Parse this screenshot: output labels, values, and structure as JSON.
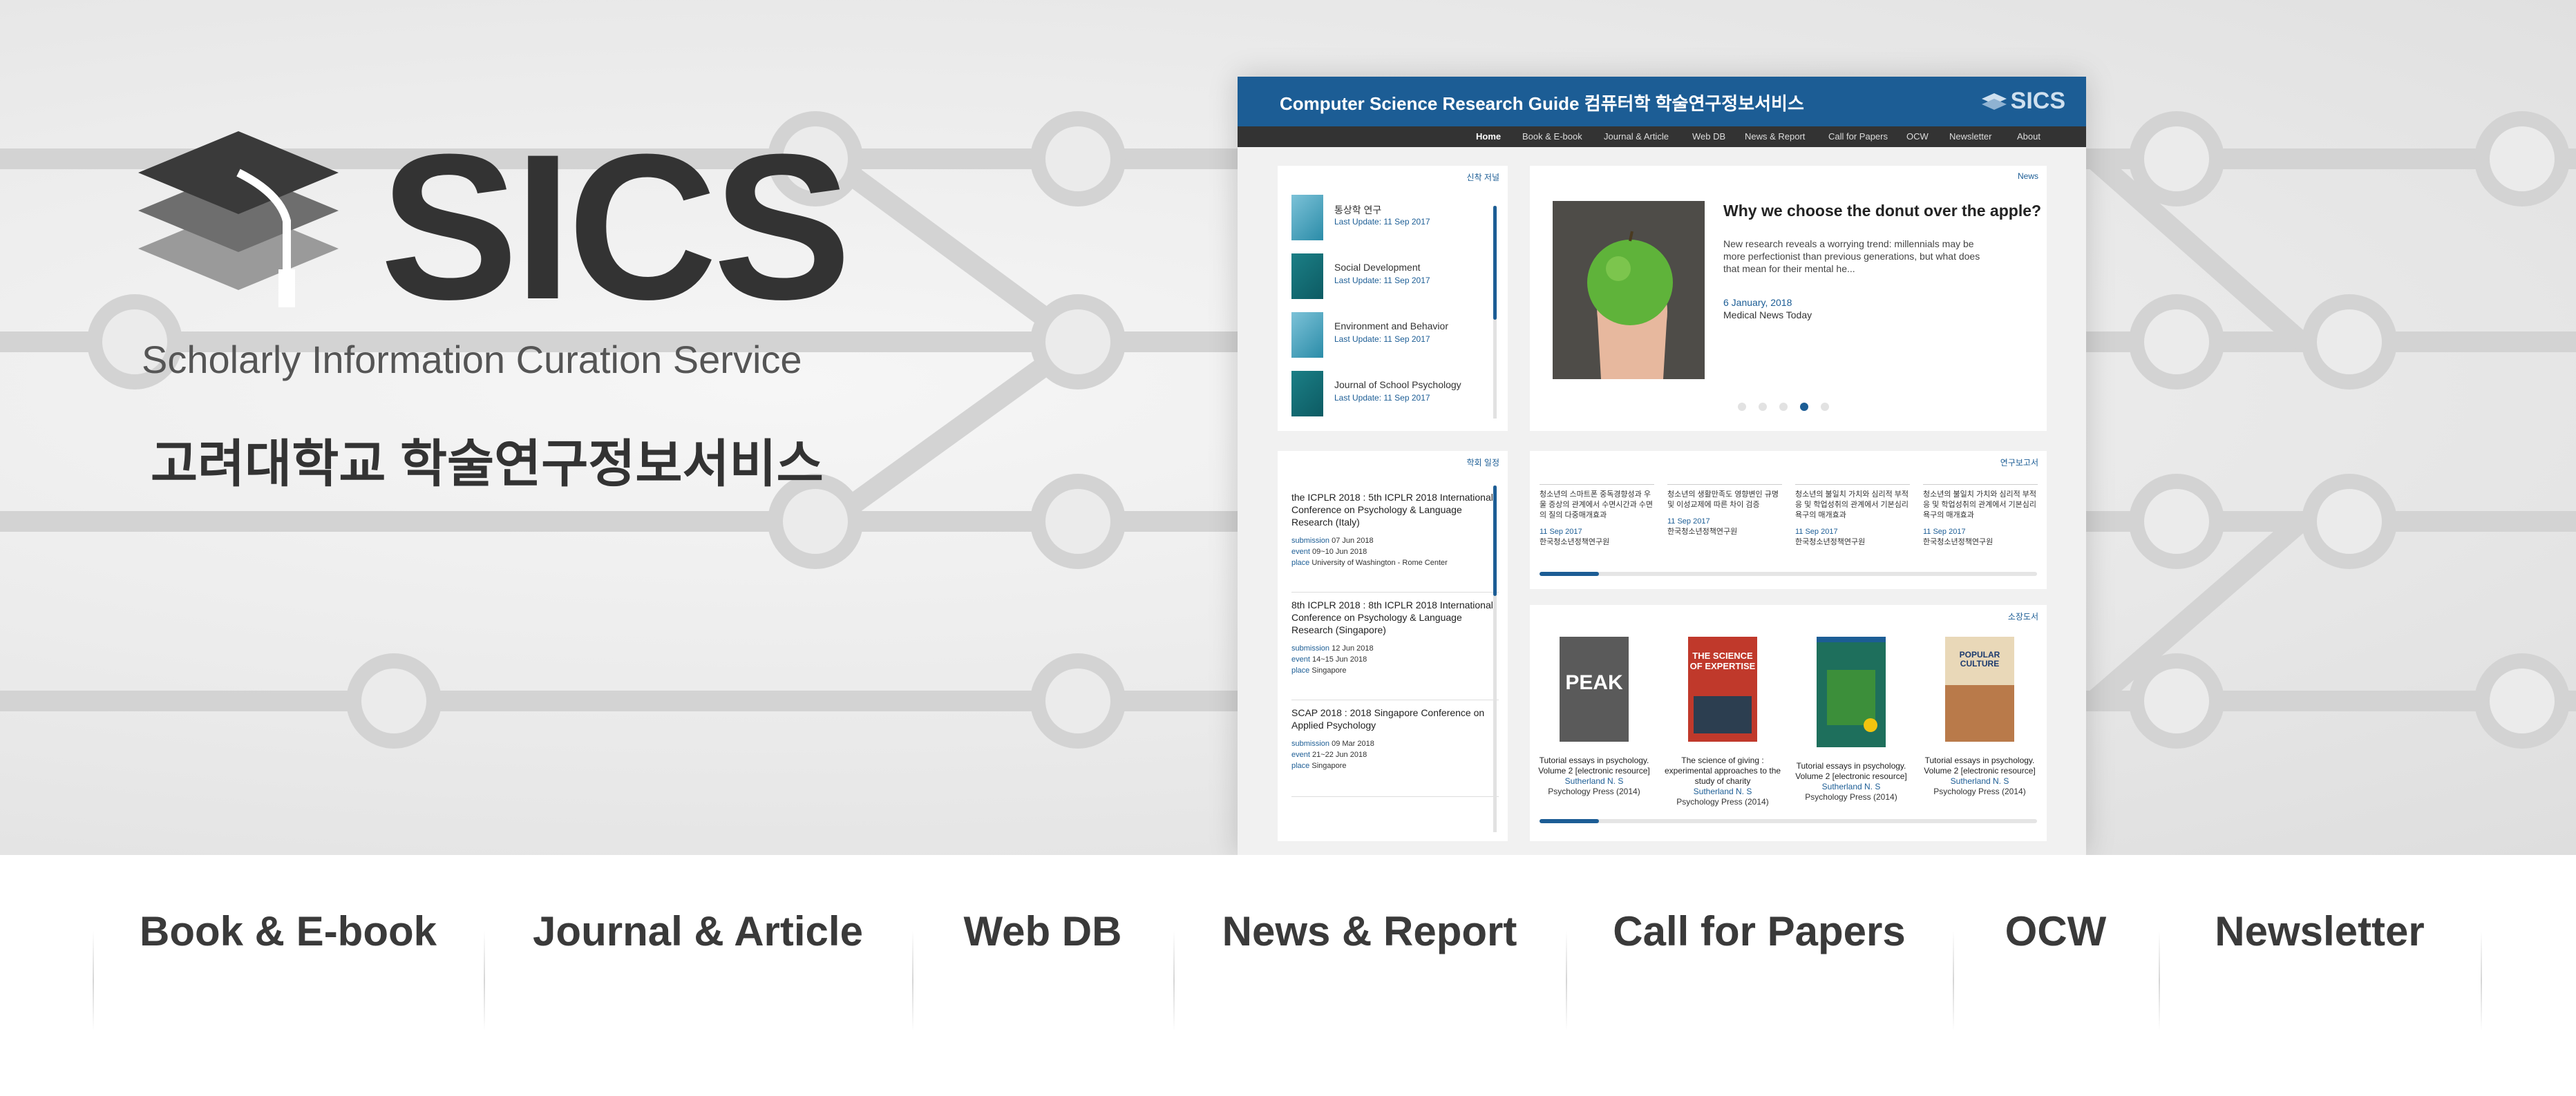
{
  "hero": {
    "logo_text": "SICS",
    "tagline": "Scholarly Information Curation Service",
    "korean_name": "고려대학교 학술연구정보서비스"
  },
  "preview": {
    "header_title": "Computer Science Research Guide 컴퓨터학 학술연구정보서비스",
    "header_logo": "SICS",
    "nav": [
      "Home",
      "Book & E-book",
      "Journal & Article",
      "Web DB",
      "News & Report",
      "Call for Papers",
      "OCW",
      "Newsletter",
      "About"
    ],
    "new_journals": {
      "label": "신착 저널",
      "items": [
        {
          "name": "통상학 연구",
          "update": "Last Update: 11 Sep 2017"
        },
        {
          "name": "Social Development",
          "update": "Last Update: 11 Sep 2017"
        },
        {
          "name": "Environment and Behavior",
          "update": "Last Update: 11 Sep 2017"
        },
        {
          "name": "Journal of School Psychology",
          "update": "Last Update: 11 Sep 2017"
        }
      ]
    },
    "news": {
      "label": "News",
      "title": "Why we choose the donut over the apple?",
      "body": "New research reveals a worrying trend: millennials may be more perfectionist than previous generations, but what does that mean for their mental he...",
      "date": "6 January, 2018",
      "source": "Medical News Today",
      "slide_count": 5,
      "active_slide": 4
    },
    "cfp": {
      "label": "학회 일정",
      "items": [
        {
          "title": "the ICPLR 2018 : 5th ICPLR 2018 International Conference on Psychology & Language Research (Italy)",
          "submission": "07 Jun 2018",
          "event": "09~10 Jun 2018",
          "place": "University of Washington - Rome Center"
        },
        {
          "title": "8th ICPLR 2018 : 8th ICPLR 2018 International Conference on Psychology & Language Research (Singapore)",
          "submission": "12 Jun 2018",
          "event": "14~15 Jun 2018",
          "place": "Singapore"
        },
        {
          "title": "SCAP 2018 : 2018 Singapore Conference on Applied Psychology",
          "submission": "09 Mar 2018",
          "event": "21~22 Jun 2018",
          "place": "Singapore"
        }
      ],
      "submission_label": "submission",
      "event_label": "event",
      "place_label": "place"
    },
    "reports": {
      "label": "연구보고서",
      "items": [
        {
          "title": "청소년의 스마트폰 중독경향성과 우울 증상의 관계에서 수면시간과 수면의 질의 다중매개효과",
          "date": "11 Sep 2017",
          "org": "한국청소년정책연구원"
        },
        {
          "title": "청소년의 생활만족도 영향변인 규명 및 이성교제에 따른 차이 검증",
          "date": "11 Sep 2017",
          "org": "한국청소년정책연구원"
        },
        {
          "title": "청소년의 불일치 가치와 심리적 부적응 및 학업성취의 관계에서 기본심리욕구의 매개효과",
          "date": "11 Sep 2017",
          "org": "한국청소년정책연구원"
        },
        {
          "title": "청소년의 불일치 가치와 심리적 부적응 및 학업성취의 관계에서 기본심리욕구의 매개효과",
          "date": "11 Sep 2017",
          "org": "한국청소년정책연구원"
        }
      ]
    },
    "books": {
      "label": "소장도서",
      "items": [
        {
          "title": "Tutorial essays in psychology. Volume 2 [electronic resource]",
          "author": "Sutherland N. S",
          "publisher": "Psychology Press (2014)",
          "cover_text": "PEAK"
        },
        {
          "title": "The science of giving : experimental approaches to the study of charity",
          "author": "Sutherland N. S",
          "publisher": "Psychology Press (2014)",
          "cover_text": "THE SCIENCE OF EXPERTISE"
        },
        {
          "title": "Tutorial essays in psychology. Volume 2 [electronic resource]",
          "author": "Sutherland N. S",
          "publisher": "Psychology Press (2014)",
          "cover_text": ""
        },
        {
          "title": "Tutorial essays in psychology. Volume 2 [electronic resource]",
          "author": "Sutherland N. S",
          "publisher": "Psychology Press (2014)",
          "cover_text": "POPULAR CULTURE"
        }
      ]
    }
  },
  "categories": [
    "Book & E-book",
    "Journal & Article",
    "Web DB",
    "News & Report",
    "Call for Papers",
    "OCW",
    "Newsletter"
  ],
  "colors": {
    "brand": "#1c5d95",
    "nav_bg": "#333333",
    "text_dark": "#3a3a3a"
  }
}
